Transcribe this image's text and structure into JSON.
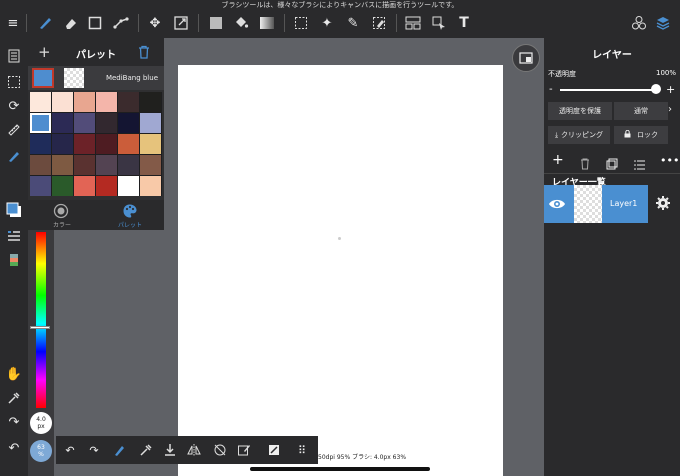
{
  "hint": "ブラシツールは、様々なブラシによりキャンバスに描画を行うツールです。",
  "palette": {
    "title": "パレット",
    "swatch_name": "MediBang blue",
    "colors": [
      "#fde8dc",
      "#fbe0d3",
      "#e8a690",
      "#f4b5aa",
      "#3b2b2d",
      "#20201e",
      "#4e8dcf",
      "#2c2a55",
      "#524c79",
      "#32282f",
      "#141532",
      "#a0a8d2",
      "#1f2c5a",
      "#26264a",
      "#6c2228",
      "#4e1c22",
      "#cb5d3a",
      "#e6c37c",
      "#6c4b3e",
      "#7e5a42",
      "#5a3230",
      "#534352",
      "#3a3544",
      "#835a48",
      "#4b4b78",
      "#2a5a2a",
      "#e26455",
      "#b42a22",
      "#ffffff",
      "#f8c9a8"
    ],
    "selected_index": 6,
    "tab_color": "カラー",
    "tab_palette": "パレット"
  },
  "left": {
    "brush_size_value": "4.0",
    "brush_size_unit": "px",
    "opacity_value": "63",
    "opacity_unit": "%"
  },
  "layer": {
    "title": "レイヤー",
    "opacity_label": "不透明度",
    "opacity_value": "100%",
    "opacity_fraction": 1.0,
    "minus": "-",
    "plus": "+",
    "protect_alpha": "透明度を保護",
    "blend_mode": "通常",
    "clipping": "クリッピング",
    "lock": "ロック",
    "list_title": "レイヤー一覧",
    "layer_name": "Layer1"
  },
  "status": "50dpi 95% ブラシ: 4.0px 63%",
  "colors": {
    "accent": "#4a8fd1",
    "toolbar_bg": "#2a2a2c",
    "canvas_bg": "#5f6166"
  }
}
